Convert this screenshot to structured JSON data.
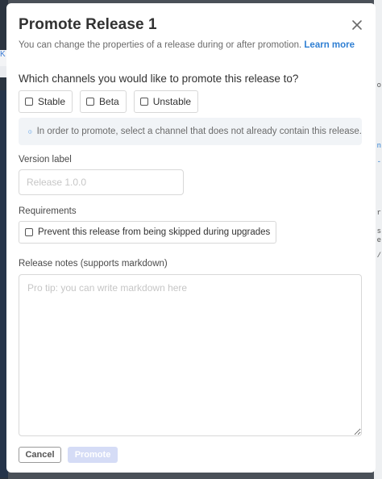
{
  "modal": {
    "title": "Promote Release 1",
    "subtitle": "You can change the properties of a release during or after promotion.",
    "learn_more": "Learn more"
  },
  "channels": {
    "question": "Which channels you would like to promote this release to?",
    "options": [
      {
        "label": "Stable",
        "checked": false
      },
      {
        "label": "Beta",
        "checked": false
      },
      {
        "label": "Unstable",
        "checked": false
      }
    ],
    "info": "In order to promote, select a channel that does not already contain this release."
  },
  "version": {
    "label": "Version label",
    "placeholder": "Release 1.0.0",
    "value": ""
  },
  "requirements": {
    "label": "Requirements",
    "option": "Prevent this release from being skipped during upgrades",
    "checked": false
  },
  "notes": {
    "label": "Release notes (supports markdown)",
    "placeholder": "Pro tip: you can write markdown here"
  },
  "footer": {
    "cancel": "Cancel",
    "promote": "Promote"
  },
  "background": {
    "left_glyph": "K",
    "right_fragments": [
      "o",
      "n",
      "-",
      "r",
      "s",
      "e",
      "/"
    ]
  },
  "colors": {
    "accent": "#2f7fd3",
    "promote_disabled": "#d5dcf6",
    "info_bg": "#f1f4f7"
  }
}
